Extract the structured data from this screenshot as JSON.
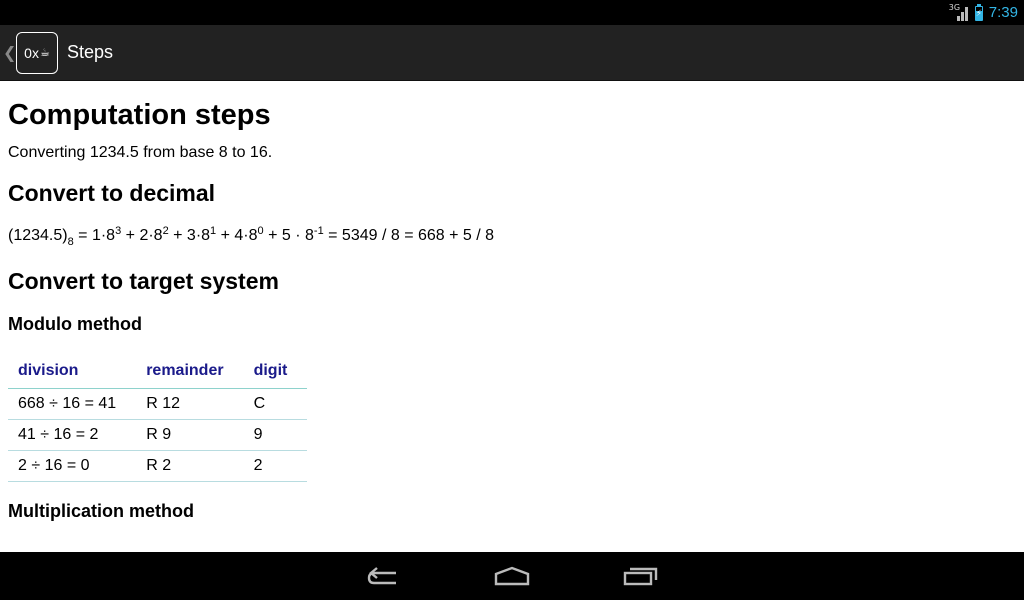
{
  "status_bar": {
    "network": "3G",
    "clock": "7:39",
    "battery_level": 0.7
  },
  "action_bar": {
    "title": "Steps",
    "app_icon_text": "0x",
    "app_icon_cup": "☕"
  },
  "page": {
    "title": "Computation steps",
    "intro": "Converting 1234.5 from base 8 to 16.",
    "section_decimal": "Convert to decimal",
    "formula": {
      "number": "(1234.5)",
      "base_sub": "8",
      "terms": [
        {
          "text": " = 1·8",
          "exp": "3"
        },
        {
          "text": " + 2·8",
          "exp": "2"
        },
        {
          "text": " + 3·8",
          "exp": "1"
        },
        {
          "text": " + 4·8",
          "exp": "0"
        },
        {
          "text": " + 5 · 8",
          "exp": "-1"
        }
      ],
      "result": " = 5349 / 8 = 668 + 5 / 8"
    },
    "section_target": "Convert to target system",
    "modulo_heading": "Modulo method",
    "modulo_table": {
      "headers": [
        "division",
        "remainder",
        "digit"
      ],
      "rows": [
        [
          "668 ÷ 16 = 41",
          "R 12",
          "C"
        ],
        [
          "41 ÷ 16 = 2",
          "R 9",
          "9"
        ],
        [
          "2 ÷ 16 = 0",
          "R 2",
          "2"
        ]
      ]
    },
    "multiplication_heading": "Multiplication method"
  },
  "colors": {
    "accent": "#33b5e5",
    "table_header": "#1a1a8a",
    "table_rule": "#8ed2cc"
  }
}
